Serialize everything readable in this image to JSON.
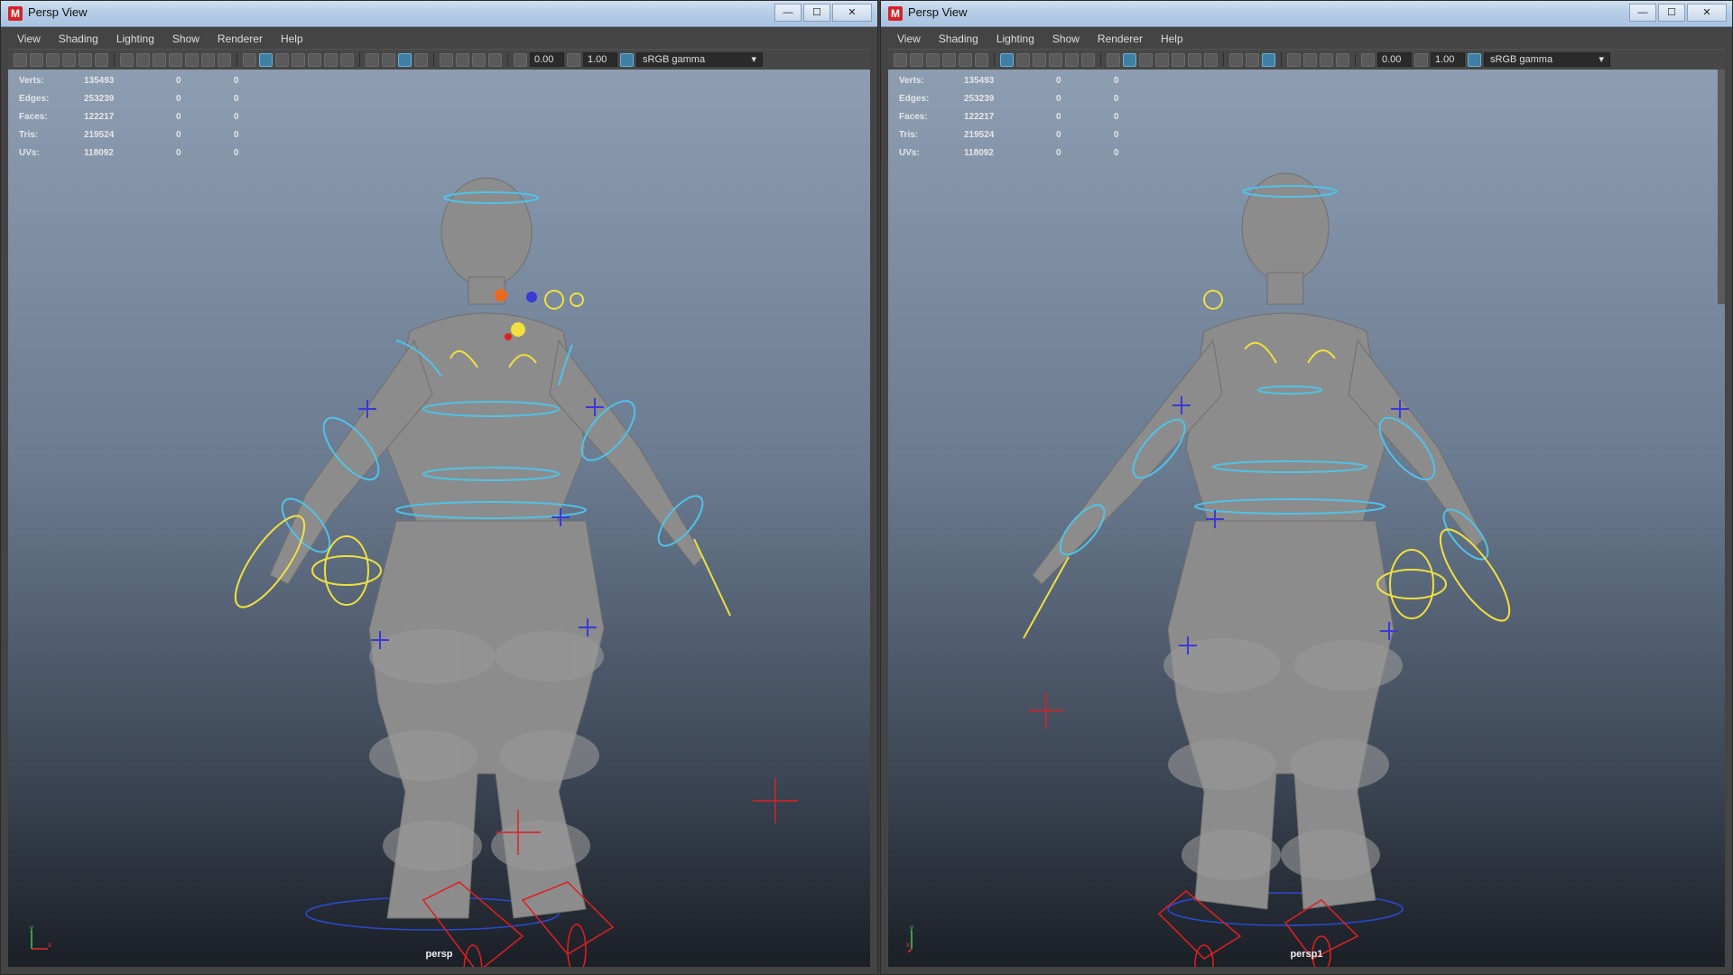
{
  "windows": [
    {
      "title": "Persp View",
      "menu": [
        "View",
        "Shading",
        "Lighting",
        "Show",
        "Renderer",
        "Help"
      ],
      "toolbar": {
        "exposure": "0.00",
        "gamma": "1.00",
        "color_space": "sRGB gamma"
      },
      "hud": [
        {
          "label": "Verts:",
          "v1": "135493",
          "v2": "0",
          "v3": "0"
        },
        {
          "label": "Edges:",
          "v1": "253239",
          "v2": "0",
          "v3": "0"
        },
        {
          "label": "Faces:",
          "v1": "122217",
          "v2": "0",
          "v3": "0"
        },
        {
          "label": "Tris:",
          "v1": "219524",
          "v2": "0",
          "v3": "0"
        },
        {
          "label": "UVs:",
          "v1": "118092",
          "v2": "0",
          "v3": "0"
        }
      ],
      "camera": "persp",
      "axis": {
        "y": "y",
        "x": "x"
      }
    },
    {
      "title": "Persp View",
      "menu": [
        "View",
        "Shading",
        "Lighting",
        "Show",
        "Renderer",
        "Help"
      ],
      "toolbar": {
        "exposure": "0.00",
        "gamma": "1.00",
        "color_space": "sRGB gamma"
      },
      "hud": [
        {
          "label": "Verts:",
          "v1": "135493",
          "v2": "0",
          "v3": "0"
        },
        {
          "label": "Edges:",
          "v1": "253239",
          "v2": "0",
          "v3": "0"
        },
        {
          "label": "Faces:",
          "v1": "122217",
          "v2": "0",
          "v3": "0"
        },
        {
          "label": "Tris:",
          "v1": "219524",
          "v2": "0",
          "v3": "0"
        },
        {
          "label": "UVs:",
          "v1": "118092",
          "v2": "0",
          "v3": "0"
        }
      ],
      "camera": "persp1",
      "axis": {
        "y": "y",
        "x": "x"
      }
    }
  ],
  "app_icon": "M",
  "window_buttons": {
    "minimize": "—",
    "maximize": "☐",
    "close": "✕"
  },
  "colors": {
    "rig_cyan": "#4fc3e8",
    "rig_yellow": "#f0e040",
    "rig_blue": "#3a3ad8",
    "rig_red": "#e02020",
    "model_gray": "#8a8a8a"
  }
}
